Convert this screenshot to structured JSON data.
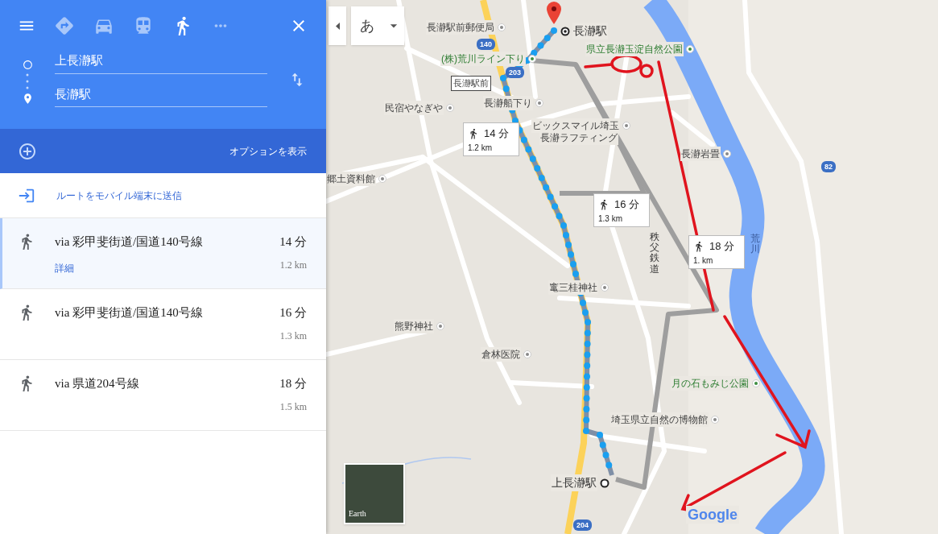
{
  "sidebar": {
    "travel_modes": [
      {
        "kind": "best",
        "selected": false
      },
      {
        "kind": "car",
        "selected": false
      },
      {
        "kind": "transit",
        "selected": false
      },
      {
        "kind": "walk",
        "selected": true
      }
    ],
    "origin": "上長瀞駅",
    "destination": "長瀞駅",
    "options_link": "オプションを表示",
    "send_to_phone": "ルートをモバイル端末に送信",
    "routes": [
      {
        "via": "via 彩甲斐街道/国道140号線",
        "time": "14 分",
        "distance": "1.2 km",
        "details": "詳細",
        "selected": true
      },
      {
        "via": "via 彩甲斐街道/国道140号線",
        "time": "16 分",
        "distance": "1.3 km",
        "selected": false
      },
      {
        "via": "via 県道204号線",
        "time": "18 分",
        "distance": "1.5 km",
        "selected": false
      }
    ]
  },
  "map": {
    "input_tool": "あ",
    "labels": [
      {
        "text": "長瀞駅前郵便局",
        "kind": "poi"
      },
      {
        "text": "長瀞駅",
        "kind": "station"
      },
      {
        "text": "県立長瀞玉淀自然公園",
        "kind": "park"
      },
      {
        "text": "(株)荒川ライン下り",
        "kind": "park"
      },
      {
        "text": "長瀞駅前",
        "kind": "stop"
      },
      {
        "text": "長瀞船下り",
        "kind": "poi"
      },
      {
        "text": "民宿やなぎや",
        "kind": "poi"
      },
      {
        "text": "ビックスマイル埼玉",
        "kind": "poi"
      },
      {
        "text": "長瀞ラフティング",
        "kind": "plain"
      },
      {
        "text": "長瀞岩畳",
        "kind": "poi"
      },
      {
        "text": "郷土資料館",
        "kind": "poi"
      },
      {
        "text": "秩父鉄道",
        "kind": "vertical"
      },
      {
        "text": "荒川",
        "kind": "river"
      },
      {
        "text": "竃三桂神社",
        "kind": "poi"
      },
      {
        "text": "熊野神社",
        "kind": "poi"
      },
      {
        "text": "倉林医院",
        "kind": "poi"
      },
      {
        "text": "月の石もみじ公園",
        "kind": "park"
      },
      {
        "text": "埼玉県立自然の博物館",
        "kind": "poi"
      },
      {
        "text": "上長瀞駅",
        "kind": "origin"
      }
    ],
    "road_shields": [
      "140",
      "203",
      "82",
      "204"
    ],
    "route_callouts": [
      {
        "time": "14 分",
        "distance": "1.2 km"
      },
      {
        "time": "16 分",
        "distance": "1.3 km"
      },
      {
        "time": "18 分",
        "distance": "1. km"
      }
    ],
    "earth_label": "Earth",
    "logo": "Google"
  }
}
